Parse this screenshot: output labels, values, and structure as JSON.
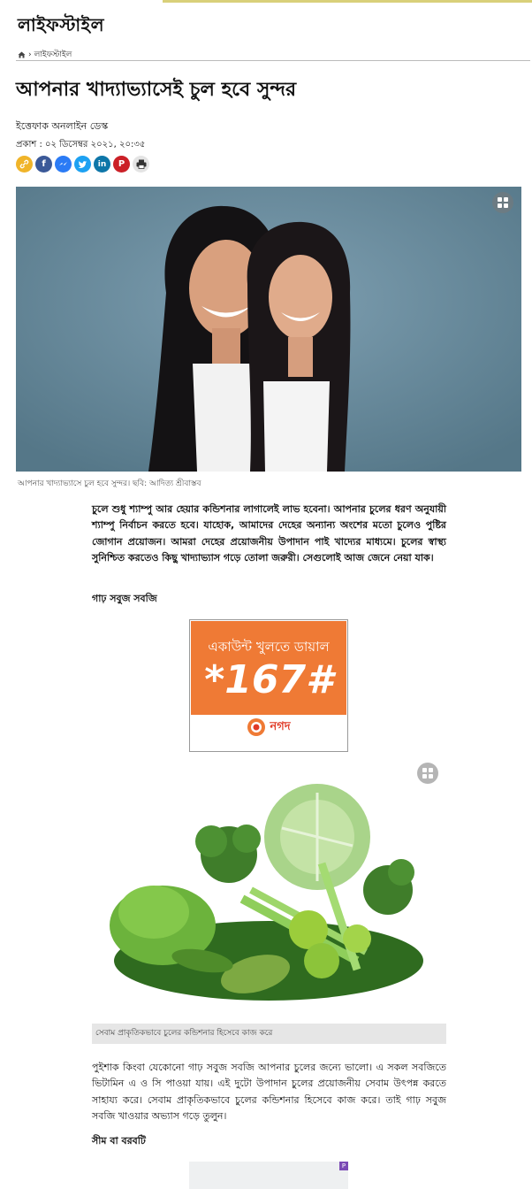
{
  "section": {
    "name": "লাইফস্টাইল"
  },
  "breadcrumb": {
    "home_icon": "home-icon",
    "separator": "›",
    "current": "লাইফস্টাইল"
  },
  "article": {
    "title": "আপনার খাদ্যাভ্যাসেই চুল হবে সুন্দর",
    "author": "ইত্তেফাক অনলাইন ডেস্ক",
    "published": "প্রকাশ : ০২ ডিসেম্বর ২০২১, ২০:৩৫",
    "share_icons": [
      "link-icon",
      "facebook-icon",
      "messenger-icon",
      "twitter-icon",
      "linkedin-icon",
      "pinterest-icon",
      "print-icon"
    ],
    "hero_caption": "আপনার খাদ্যাভ্যাসে চুল হবে সুন্দর। ছবি: আদিত্য শ্রীবাস্তব",
    "intro": "চুলে শুধু শ্যাম্পু আর হেয়ার কন্ডিশনার লাগালেই লাভ হবেনা। আপনার চুলের ধরণ অনুযায়ী শ্যাম্পু নির্বাচন করতে হবে। যাহোক, আমাদের দেহের অন্যান্য অংশের মতো চুলেও পুষ্টির জোগান প্রয়োজন। আমরা দেহের প্রয়োজনীয় উপাদান পাই খাদ্যের মাধ্যমে। চুলের স্বাস্থ্য সুনিশ্চিত করতেও কিছু খাদ্যাভ্যাস গড়ে তোলা জরুরী। সেগুলোই আজ জেনে নেয়া যাক।",
    "subhead1": "গাঢ় সবুজ সবজি",
    "veg_caption": "সেবাম প্রাকৃতিকভাবে চুলের কন্ডিশনার হিসেবে কাজ করে",
    "para2": "পুইশাক কিংবা যেকোনো গাঢ় সবুজ সবজি আপনার চুলের জন্যে ভালো। এ সকল সবজিতে ভিটামিন এ ও সি পাওয়া যায়। এই দুটো উপাদান চুলের প্রয়োজনীয় সেবাম উৎপন্ন করতে সাহায্য করে। সেবাম প্রাকৃতিকভাবে চুলের কন্ডিশনার হিসেবে কাজ করে। তাই গাঢ় সবুজ সবজি খাওয়ার অভ্যাস গড়ে তুলুন।",
    "subhead2": "সীম বা বরবটি"
  },
  "ad": {
    "line1": "একাউন্ট খুলতে ডায়াল",
    "number": "*167#",
    "brand": "নগদ",
    "brand_color": "#ef7a35"
  },
  "colors": {
    "facebook": "#3b5998",
    "messenger": "#2b7bf5",
    "twitter": "#1da1f2",
    "linkedin": "#0e76a8",
    "pinterest": "#cb2027",
    "link": "#f0b429",
    "print": "#555555"
  }
}
